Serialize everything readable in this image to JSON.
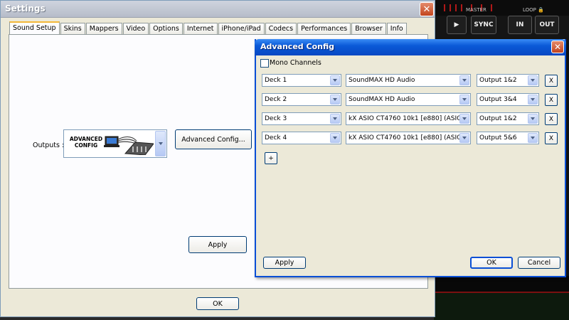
{
  "background_app": {
    "master_label": "MASTER",
    "loop_label": "LOOP",
    "buttons": [
      "SYNC",
      "IN",
      "OUT"
    ],
    "play_icon": "play-icon",
    "lock_icon": "lock-icon"
  },
  "settings": {
    "title": "Settings",
    "tabs": [
      "Sound Setup",
      "Skins",
      "Mappers",
      "Video",
      "Options",
      "Internet",
      "iPhone/iPad",
      "Codecs",
      "Performances",
      "Browser",
      "Info"
    ],
    "active_tab": "Sound Setup",
    "outputs_label": "Outputs :",
    "outputs_value": "ADVANCED CONFIG",
    "advanced_config_button": "Advanced Config...",
    "apply_button": "Apply",
    "ok_button": "OK"
  },
  "advanced": {
    "title": "Advanced Config",
    "mono_label": "Mono Channels",
    "mono_checked": false,
    "rows": [
      {
        "deck": "Deck 1",
        "device": "SoundMAX HD Audio",
        "output": "Output 1&2",
        "remove": "X"
      },
      {
        "deck": "Deck 2",
        "device": "SoundMAX HD Audio",
        "output": "Output 3&4",
        "remove": "X"
      },
      {
        "deck": "Deck 3",
        "device": "kX ASIO CT4760 10k1 [e880] (ASIO)",
        "output": "Output 1&2",
        "remove": "X"
      },
      {
        "deck": "Deck 4",
        "device": "kX ASIO CT4760 10k1 [e880] (ASIO)",
        "output": "Output 5&6",
        "remove": "X"
      }
    ],
    "add_button": "+",
    "apply_button": "Apply",
    "ok_button": "OK",
    "cancel_button": "Cancel"
  },
  "colors": {
    "xp_blue_title": "#0a5ad8",
    "tab_highlight": "#f4b83a",
    "close_red": "#c2441e"
  }
}
